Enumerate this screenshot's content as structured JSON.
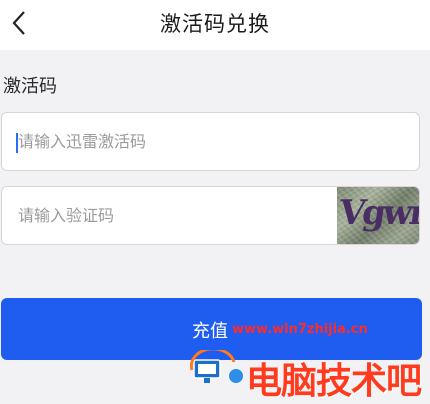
{
  "header": {
    "title": "激活码兑换"
  },
  "section": {
    "label": "激活码"
  },
  "fields": {
    "activation_code": {
      "value": "",
      "placeholder": "请输入迅雷激活码"
    },
    "captcha": {
      "value": "",
      "placeholder": "请输入验证码",
      "image_text": "Vgwm"
    }
  },
  "submit": {
    "label": "充值"
  },
  "watermark": {
    "url": "www.win7zhijia.cn",
    "brand": "电脑技术吧"
  },
  "colors": {
    "primary": "#1f5cf0",
    "background": "#f2f2f4",
    "watermark": "#ff2a2a"
  }
}
